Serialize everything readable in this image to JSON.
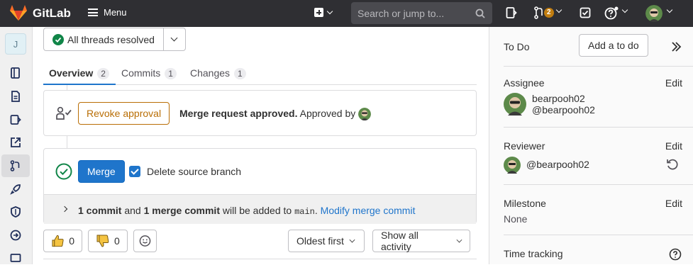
{
  "topbar": {
    "brand": "GitLab",
    "menu_label": "Menu",
    "search_placeholder": "Search or jump to...",
    "merge_requests_count": "2"
  },
  "sidebar": {
    "project_letter": "J"
  },
  "threads": {
    "label": "All threads resolved"
  },
  "tabs": [
    {
      "label": "Overview",
      "count": "2"
    },
    {
      "label": "Commits",
      "count": "1"
    },
    {
      "label": "Changes",
      "count": "1"
    }
  ],
  "approval": {
    "revoke_label": "Revoke approval",
    "status_bold": "Merge request approved.",
    "approved_by": "Approved by"
  },
  "merge": {
    "button_label": "Merge",
    "delete_branch_label": "Delete source branch",
    "delete_branch_checked": true,
    "info_commit": "1 commit",
    "info_and": "and",
    "info_merge_commit": "1 merge commit",
    "info_mid": "will be added to",
    "info_branch": "main",
    "info_end": ".",
    "modify_link": "Modify merge commit"
  },
  "reactions": {
    "thumbs_up_count": "0",
    "thumbs_down_count": "0",
    "sort_label": "Oldest first",
    "filter_label": "Show all activity"
  },
  "right_sidebar": {
    "todo_label": "To Do",
    "add_todo": "Add a to do",
    "assignee_label": "Assignee",
    "assignee_edit": "Edit",
    "assignee_name": "bearpooh02",
    "assignee_handle": "@bearpooh02",
    "reviewer_label": "Reviewer",
    "reviewer_edit": "Edit",
    "reviewer_handle": "@bearpooh02",
    "milestone_label": "Milestone",
    "milestone_edit": "Edit",
    "milestone_value": "None",
    "time_tracking_label": "Time tracking"
  },
  "colors": {
    "topbar": "#2f2f33",
    "accent_blue": "#1f75cb",
    "success_green": "#108548",
    "warning_orange": "#b96e05",
    "badge": "#c17d10"
  }
}
